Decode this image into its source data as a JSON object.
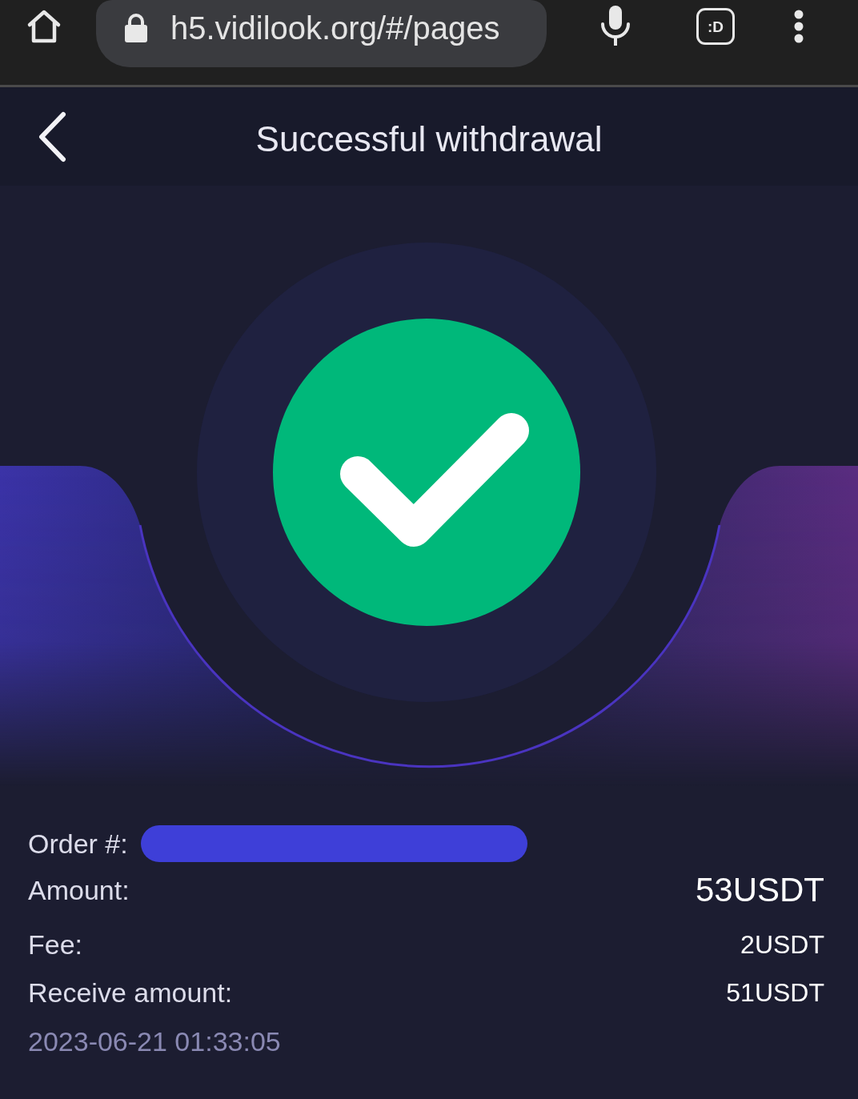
{
  "browser_bar": {
    "url": "h5.vidilook.org/#/pages",
    "extension_label": ":D"
  },
  "header": {
    "title": "Successful withdrawal"
  },
  "details": {
    "order": {
      "label": "Order #:",
      "redacted": true
    },
    "rows": [
      {
        "label": "Amount:",
        "value": "53USDT",
        "kind": "large"
      },
      {
        "label": "Fee:",
        "value": "2USDT",
        "kind": "normal"
      },
      {
        "label": "Receive amount:",
        "value": "51USDT",
        "kind": "normal"
      }
    ],
    "timestamp": "2023-06-21 01:33:05"
  }
}
